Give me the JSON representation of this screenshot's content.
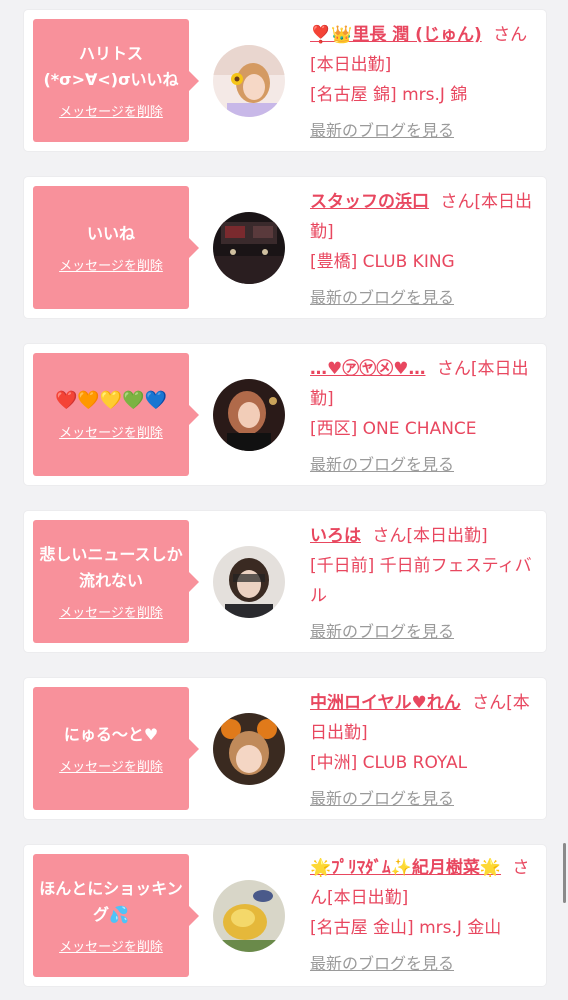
{
  "cards": [
    {
      "message": "ハリトス\n(*σ>∀<)σいいね",
      "delete_label": "メッセージを削除",
      "name": "❣️👑里長 潤 (じゅん)",
      "suffix": "さん[本日出勤]",
      "shop": "[名古屋 錦] mrs.J 錦",
      "blog_label": "最新のブログを見る"
    },
    {
      "message": "いいね",
      "delete_label": "メッセージを削除",
      "name": "スタッフの浜口",
      "suffix": "さん[本日出勤]",
      "shop": "[豊橋] CLUB KING",
      "blog_label": "最新のブログを見る"
    },
    {
      "message": "❤️🧡💛💚💙",
      "delete_label": "メッセージを削除",
      "name": "…♥㋐㋳㋱♥…",
      "suffix": "さん[本日出勤]",
      "shop": "[西区] ONE CHANCE",
      "blog_label": "最新のブログを見る"
    },
    {
      "message": "悲しいニュースしか流れない",
      "delete_label": "メッセージを削除",
      "name": "いろは",
      "suffix": "さん[本日出勤]",
      "shop": "[千日前] 千日前フェスティバル",
      "blog_label": "最新のブログを見る"
    },
    {
      "message": "にゅる〜と♥",
      "delete_label": "メッセージを削除",
      "name": "中洲ロイヤル♥れん",
      "suffix": "さん[本日出勤]",
      "shop": "[中洲] CLUB ROYAL",
      "blog_label": "最新のブログを見る"
    },
    {
      "message": "ほんとにショッキング💦",
      "delete_label": "メッセージを削除",
      "name": "🌟ﾌﾟﾘﾏﾀﾞﾑ✨紀月樹菜🌟",
      "suffix": "さん[本日出勤]",
      "shop": "[名古屋 金山] mrs.J 金山",
      "blog_label": "最新のブログを見る"
    }
  ],
  "colors": {
    "accent": "#f8919b",
    "name_text": "#e8475f",
    "link_grey": "#9a9a9a",
    "background": "#f2f2f4"
  }
}
